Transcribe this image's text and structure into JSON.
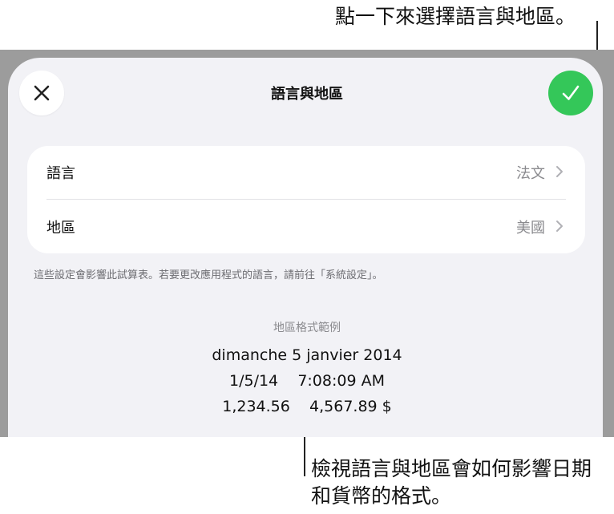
{
  "callouts": {
    "top": "點一下來選擇語言與地區。",
    "bottom": "檢視語言與地區會如何影響日期和貨幣的格式。"
  },
  "sheet": {
    "title": "語言與地區",
    "close_icon": "close-icon",
    "done_icon": "checkmark-icon",
    "accent_color": "#34c759"
  },
  "settings": {
    "language": {
      "label": "語言",
      "value": "法文"
    },
    "region": {
      "label": "地區",
      "value": "美國"
    },
    "note": "這些設定會影響此試算表。若要更改應用程式的語言，請前往「系統設定」。"
  },
  "sample": {
    "title": "地區格式範例",
    "date_long": "dimanche 5 janvier 2014",
    "date_short": "1/5/14",
    "time": "7:08:09 AM",
    "number": "1,234.56",
    "currency": "4,567.89 $"
  }
}
